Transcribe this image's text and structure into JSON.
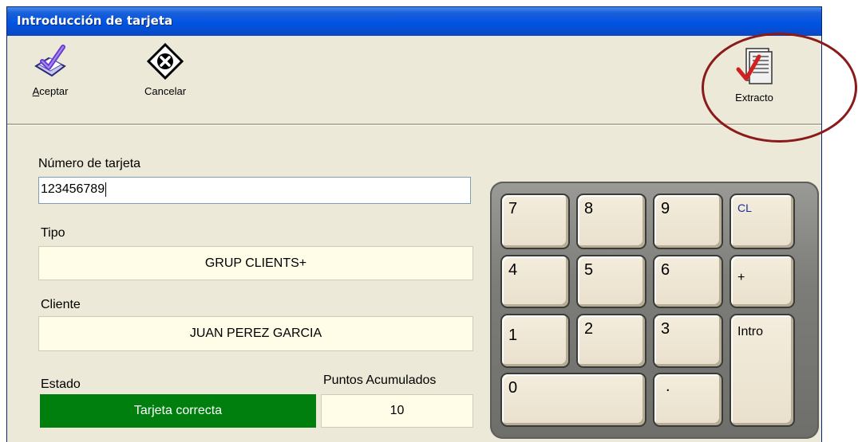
{
  "window": {
    "title": "Introducción de tarjeta"
  },
  "toolbar": {
    "accept": {
      "label_u": "A",
      "label_rest": "ceptar",
      "icon": "check-icon"
    },
    "cancel": {
      "label": "Cancelar",
      "icon": "cancel-icon"
    },
    "extract": {
      "label": "Extracto",
      "icon": "document-check-icon"
    }
  },
  "card": {
    "label": "Número de tarjeta",
    "value": "123456789"
  },
  "tipo": {
    "label": "Tipo",
    "value": "GRUP CLIENTS+"
  },
  "cliente": {
    "label": "Cliente",
    "value": "JUAN PEREZ GARCIA"
  },
  "estado": {
    "label": "Estado",
    "value": "Tarjeta correcta"
  },
  "puntos": {
    "label": "Puntos Acumulados",
    "value": "10"
  },
  "keypad": {
    "k7": "7",
    "k8": "8",
    "k9": "9",
    "cl": "CL",
    "k4": "4",
    "k5": "5",
    "k6": "6",
    "plus": "+",
    "k1": "1",
    "k2": "2",
    "k3": "3",
    "intro": "Intro",
    "k0": "0",
    "dot": "."
  },
  "colors": {
    "status_ok": "#007f0e",
    "highlight": "#8b1a1a",
    "title_bar": "#0054e3"
  }
}
